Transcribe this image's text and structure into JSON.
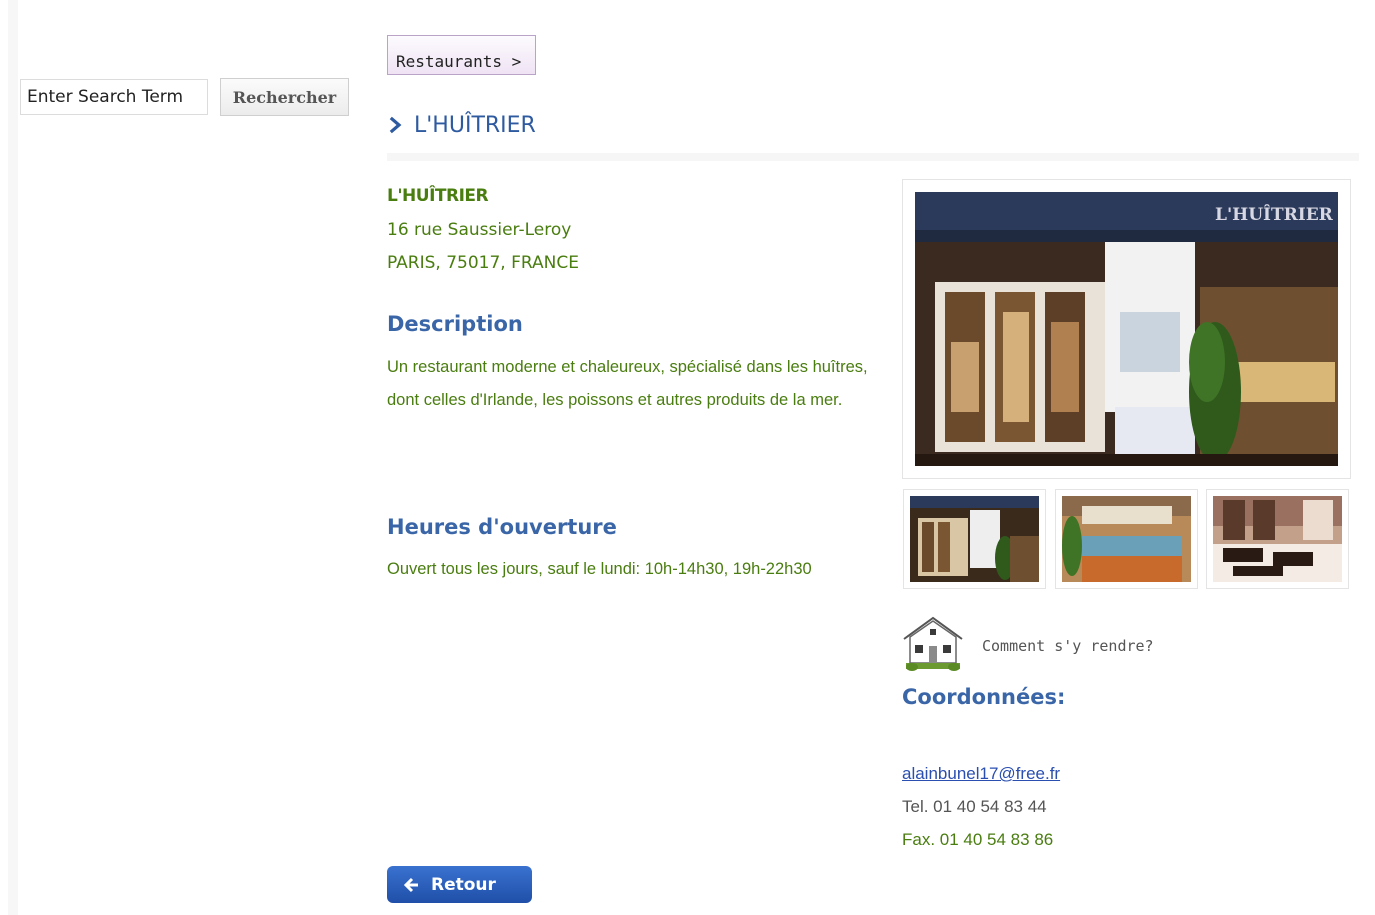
{
  "search": {
    "placeholder": "Enter Search Term",
    "button_label": "Rechercher"
  },
  "breadcrumb": {
    "label": "Restaurants >"
  },
  "restaurant": {
    "title": "L'HUÎTRIER",
    "name": "L'HUÎTRIER",
    "street": "16 rue Saussier-Leroy",
    "city_line": "PARIS, 75017, FRANCE"
  },
  "description": {
    "heading": "Description",
    "text": "Un restaurant moderne et chaleureux, spécialisé dans les huîtres, dont celles d'Irlande, les poissons et autres produits de la mer."
  },
  "hours": {
    "heading": "Heures d'ouverture",
    "text": "Ouvert tous les jours, sauf le lundi: 10h-14h30, 19h-22h30"
  },
  "gallery": {
    "main_sign_text": "L'HUÎTRIER",
    "thumbnail_count": 3
  },
  "directions": {
    "label": "Comment s'y rendre?"
  },
  "contact": {
    "heading": "Coordonnées:",
    "email": "alainbunel17@free.fr",
    "phone": "Tel. 01 40 54 83 44",
    "fax": "Fax. 01 40 54 83 86"
  },
  "back": {
    "label": "Retour"
  },
  "colors": {
    "heading_blue": "#3a66a8",
    "text_green": "#4a7d10",
    "button_blue": "#2a5cbc"
  }
}
